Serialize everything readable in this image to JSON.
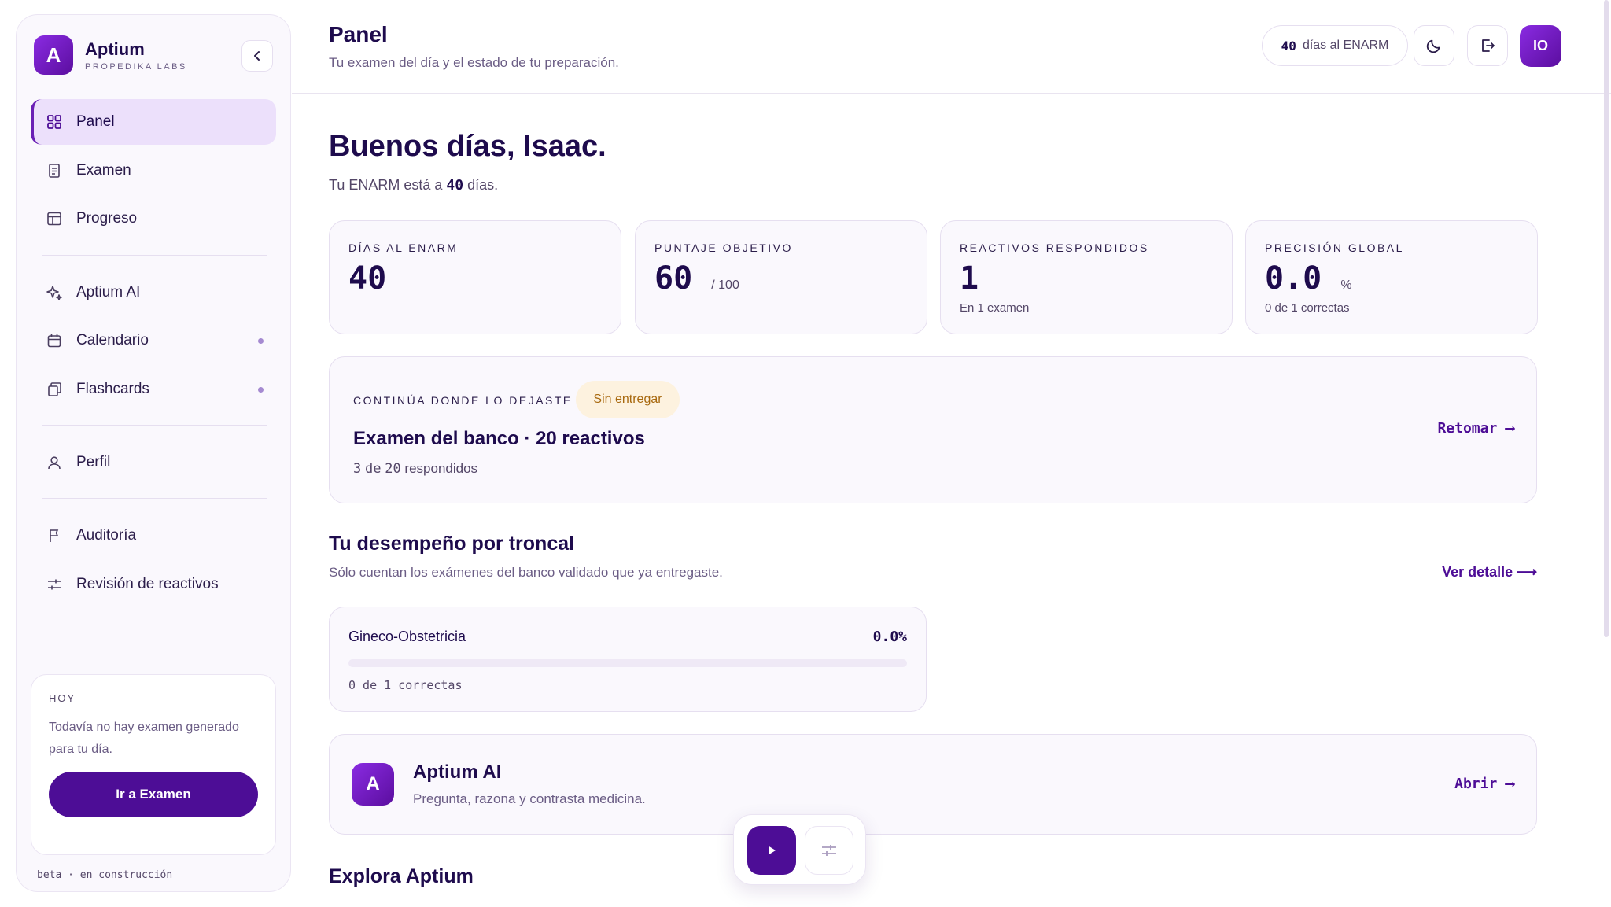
{
  "brand": {
    "logo_letter": "A",
    "name": "Aptium",
    "subtitle": "PROPEDIKA LABS"
  },
  "sidebar": {
    "items": [
      {
        "label": "Panel",
        "icon": "grid-icon",
        "active": true
      },
      {
        "label": "Examen",
        "icon": "document-icon"
      },
      {
        "label": "Progreso",
        "icon": "table-icon"
      },
      {
        "label": "Aptium AI",
        "icon": "sparkle-icon"
      },
      {
        "label": "Calendario",
        "icon": "calendar-icon",
        "dot": true
      },
      {
        "label": "Flashcards",
        "icon": "cards-icon",
        "dot": true
      },
      {
        "label": "Perfil",
        "icon": "user-icon"
      },
      {
        "label": "Auditoría",
        "icon": "flag-icon"
      },
      {
        "label": "Revisión de reactivos",
        "icon": "sliders-icon"
      }
    ],
    "today": {
      "label": "HOY",
      "text": "Todavía no hay examen generado para tu día.",
      "button": "Ir a Examen"
    },
    "footer": "beta · en construcción"
  },
  "header": {
    "title": "Panel",
    "subtitle": "Tu examen del día y el estado de tu preparación.",
    "days_value": "40",
    "days_label": "días al ENARM",
    "avatar_initials": "IO"
  },
  "greeting": {
    "title": "Buenos días, Isaac.",
    "sub_prefix": "Tu ENARM está a",
    "sub_value": "40",
    "sub_suffix": "días."
  },
  "stats": [
    {
      "label": "DÍAS AL ENARM",
      "value": "40",
      "unit": "",
      "note": ""
    },
    {
      "label": "PUNTAJE OBJETIVO",
      "value": "60",
      "unit": "/ 100",
      "note": ""
    },
    {
      "label": "REACTIVOS RESPONDIDOS",
      "value": "1",
      "unit": "",
      "note": "En 1 examen"
    },
    {
      "label": "PRECISIÓN GLOBAL",
      "value": "0.0",
      "unit": "%",
      "note": "0 de 1 correctas"
    }
  ],
  "resume": {
    "label": "CONTINÚA DONDE LO DEJASTE",
    "badge": "Sin entregar",
    "title": "Examen del banco · 20 reactivos",
    "count_done": "3",
    "count_word": "de",
    "count_total": "20",
    "count_suffix": "respondidos",
    "link": "Retomar"
  },
  "performance": {
    "title": "Tu desempeño por troncal",
    "subtitle": "Sólo cuentan los exámenes del banco validado que ya entregaste.",
    "link": "Ver detalle",
    "items": [
      {
        "name": "Gineco-Obstetricia",
        "pct": "0.0%",
        "fill": 0,
        "note": "0 de 1 correctas"
      }
    ]
  },
  "ai_card": {
    "logo_letter": "A",
    "title": "Aptium AI",
    "subtitle": "Pregunta, razona y contrasta medicina.",
    "link": "Abrir"
  },
  "explore": {
    "title": "Explora Aptium"
  },
  "colors": {
    "accent": "#4d0d96",
    "brand_gradient_start": "#8a2be2",
    "badge_bg": "#fdf2df",
    "badge_text": "#a8690f"
  }
}
